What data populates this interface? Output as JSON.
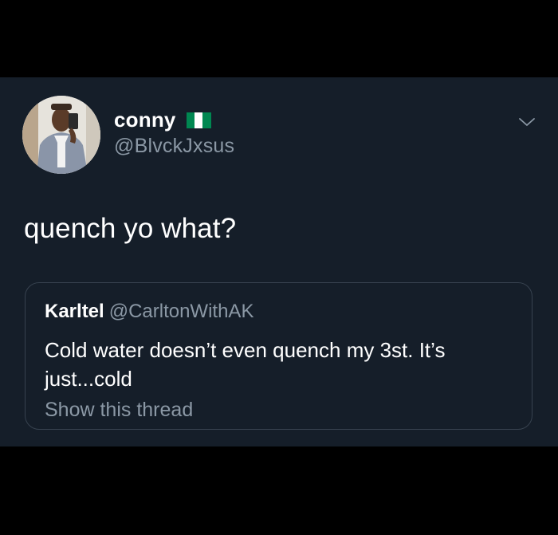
{
  "tweet": {
    "author": {
      "display_name": "conny",
      "handle": "@BlvckJxsus",
      "flag_icon": "nigeria-flag-icon",
      "flag_colors": [
        "#008751",
        "#ffffff",
        "#008751"
      ]
    },
    "caret_icon": "chevron-down-icon",
    "text": "quench yo what?",
    "quoted": {
      "display_name": "Karltel",
      "handle": "@CarltonWithAK",
      "text": "Cold water doesn’t even quench my 3st. It’s just...cold",
      "show_thread_label": "Show this thread"
    }
  },
  "colors": {
    "page_background": "#000000",
    "tweet_background": "#151e29",
    "primary_text": "#ffffff",
    "secondary_text": "#8b98a5",
    "border": "#37424f"
  }
}
